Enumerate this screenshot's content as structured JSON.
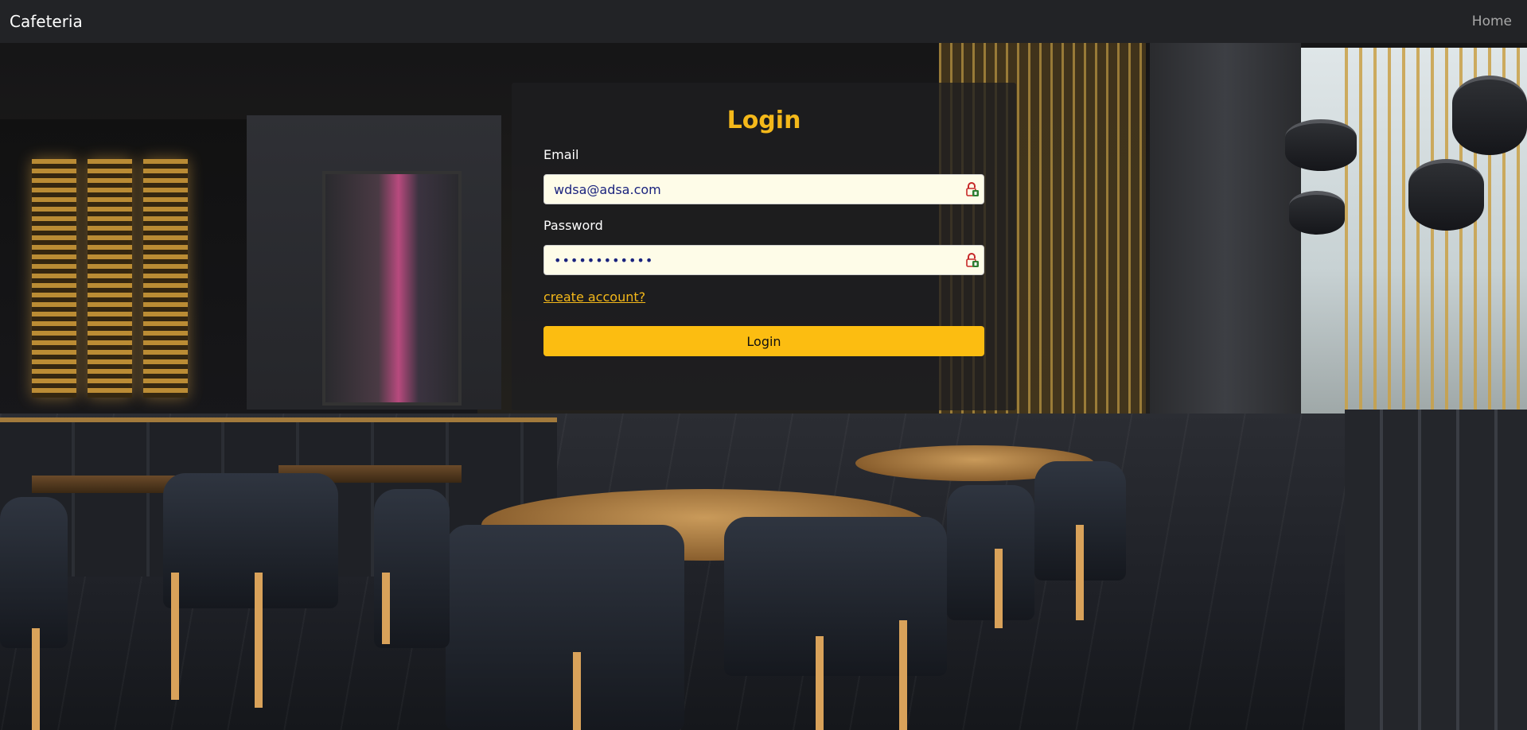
{
  "navbar": {
    "brand": "Cafeteria",
    "home_link": "Home"
  },
  "login": {
    "title": "Login",
    "email_label": "Email",
    "email_value": "wdsa@adsa.com",
    "password_label": "Password",
    "password_value": "••••••••••••",
    "create_account_link": "create account?",
    "submit_label": "Login"
  },
  "colors": {
    "accent": "#fcbd11",
    "title": "#f4b81a",
    "navbar": "#222326",
    "input_bg": "#fefce8"
  },
  "icons": [
    "password-manager-lock-icon"
  ]
}
